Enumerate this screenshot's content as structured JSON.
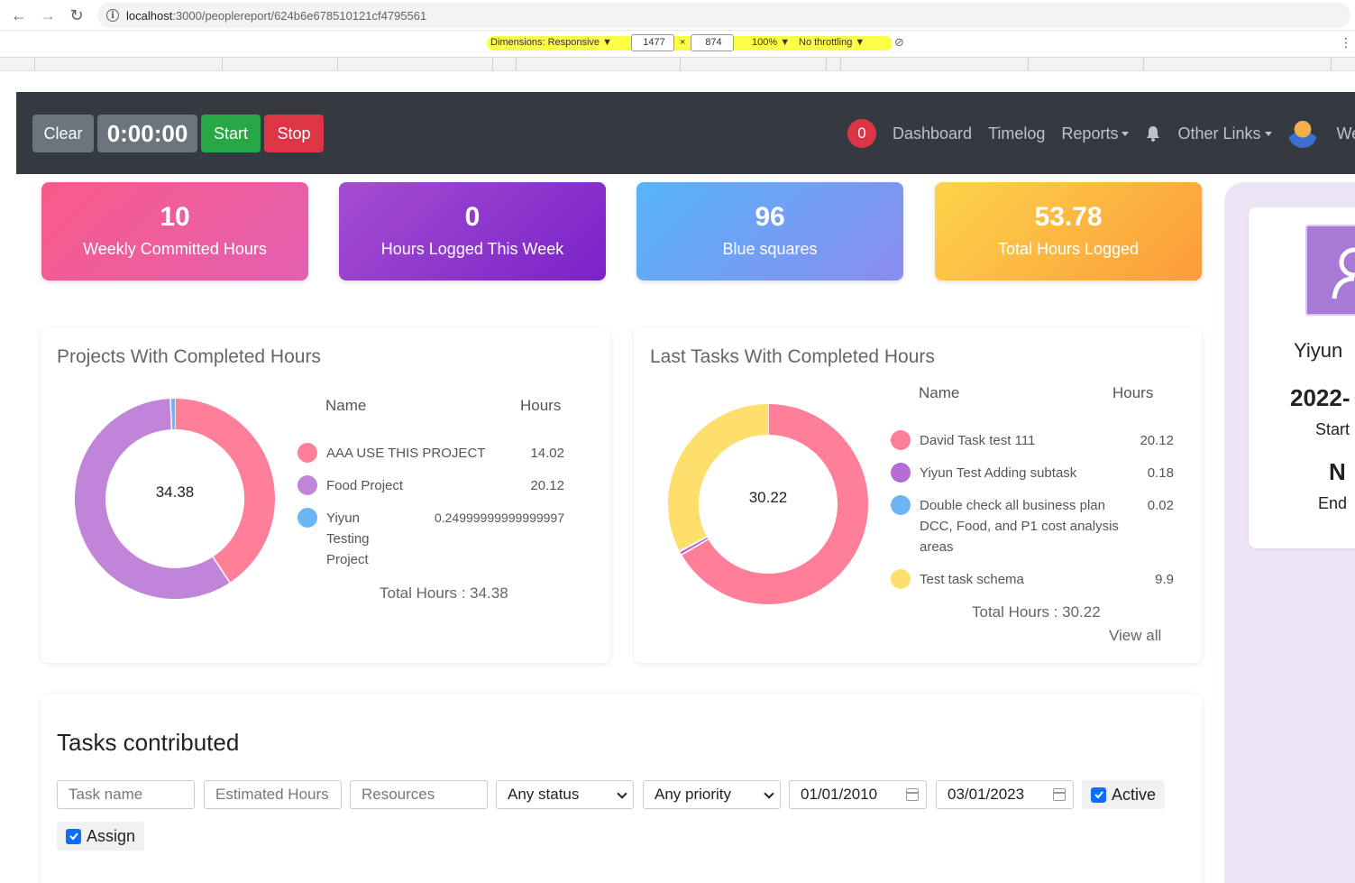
{
  "browser": {
    "back": "←",
    "forward": "→",
    "reload": "↻",
    "url_host": "localhost",
    "url_path": ":3000/peoplereport/624b6e678510121cf4795561"
  },
  "devtools": {
    "dimensions": "Dimensions: Responsive ▼",
    "width": "1477",
    "times": "×",
    "height": "874",
    "zoom": "100% ▼",
    "throttling": "No throttling ▼"
  },
  "navbar": {
    "clear": "Clear",
    "timer": "0:00:00",
    "start": "Start",
    "stop": "Stop",
    "badge": "0",
    "links": [
      "Dashboard",
      "Timelog",
      "Reports",
      "Other Links"
    ],
    "welcome": "We"
  },
  "stats": [
    {
      "value": "10",
      "label": "Weekly Committed Hours"
    },
    {
      "value": "0",
      "label": "Hours Logged This Week"
    },
    {
      "value": "96",
      "label": "Blue squares"
    },
    {
      "value": "53.78",
      "label": "Total Hours Logged"
    }
  ],
  "profile": {
    "name": "Yiyun",
    "date": "2022-",
    "start_label": "Start",
    "end_value": "N",
    "end_label": "End"
  },
  "projects": {
    "title": "Projects With Completed Hours",
    "center": "34.38",
    "col_name": "Name",
    "col_hours": "Hours",
    "rows": [
      {
        "name": "AAA USE THIS PROJECT",
        "hours": "14.02",
        "color": "#ff7f98"
      },
      {
        "name": "Food Project",
        "hours": "20.12",
        "color": "#c084d8"
      },
      {
        "name": "Yiyun Testing Project",
        "hours": "0.24999999999999997",
        "color": "#6bb6f5"
      }
    ],
    "total": "Total Hours : 34.38"
  },
  "tasks_chart": {
    "title": "Last Tasks With Completed Hours",
    "center": "30.22",
    "col_name": "Name",
    "col_hours": "Hours",
    "rows": [
      {
        "name": "David Task test 111",
        "hours": "20.12",
        "color": "#ff7f98"
      },
      {
        "name": "Yiyun Test Adding subtask",
        "hours": "0.18",
        "color": "#b66ad6"
      },
      {
        "name": "Double check all business plan DCC, Food, and P1 cost analysis areas",
        "hours": "0.02",
        "color": "#6bb6f5"
      },
      {
        "name": "Test task schema",
        "hours": "9.9",
        "color": "#ffdf6b"
      }
    ],
    "total": "Total Hours : 30.22",
    "view_all": "View all"
  },
  "chart_data": [
    {
      "type": "pie",
      "title": "Projects With Completed Hours",
      "categories": [
        "AAA USE THIS PROJECT",
        "Food Project",
        "Yiyun Testing Project"
      ],
      "values": [
        14.02,
        20.12,
        0.25
      ]
    },
    {
      "type": "pie",
      "title": "Last Tasks With Completed Hours",
      "categories": [
        "David Task test 111",
        "Yiyun Test Adding subtask",
        "Double check all business plan DCC, Food, and P1 cost analysis areas",
        "Test task schema"
      ],
      "values": [
        20.12,
        0.18,
        0.02,
        9.9
      ]
    }
  ],
  "tasks_section": {
    "title": "Tasks contributed",
    "task_name_ph": "Task name",
    "est_hours_ph": "Estimated Hours",
    "resources_ph": "Resources",
    "status": "Any status",
    "priority": "Any priority",
    "from_date": "01/01/2010",
    "to_date": "03/01/2023",
    "active": "Active",
    "assign": "Assign"
  }
}
